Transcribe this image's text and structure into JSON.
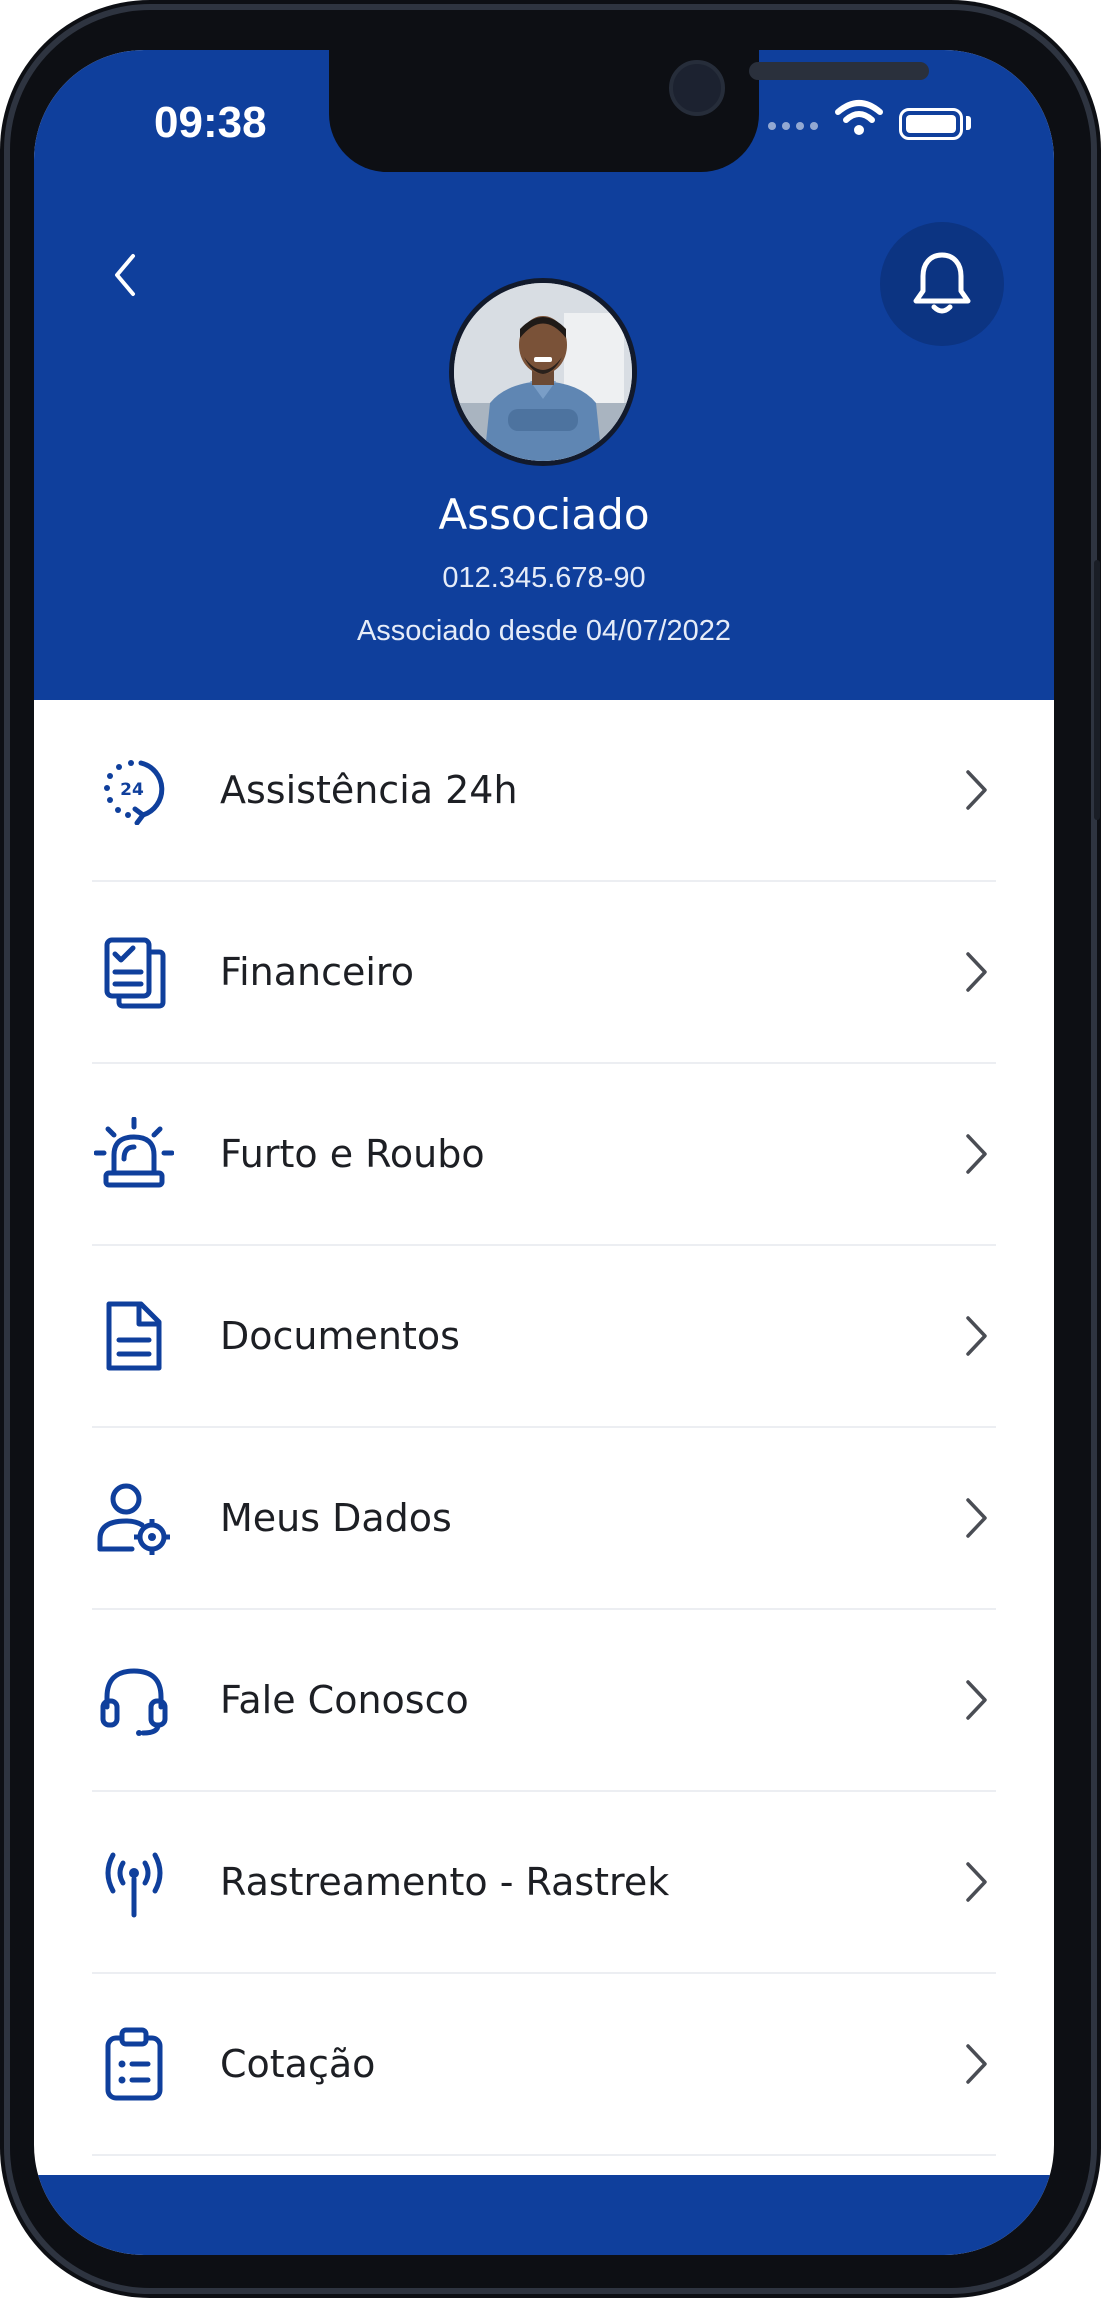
{
  "status_bar": {
    "time": "09:38"
  },
  "profile": {
    "name": "Associado",
    "document": "012.345.678-90",
    "member_since": "Associado desde 04/07/2022"
  },
  "menu": [
    {
      "label": "Assistência 24h",
      "icon": "24h-assistance-icon"
    },
    {
      "label": "Financeiro",
      "icon": "financial-document-icon"
    },
    {
      "label": "Furto e Roubo",
      "icon": "alarm-siren-icon"
    },
    {
      "label": "Documentos",
      "icon": "document-icon"
    },
    {
      "label": "Meus Dados",
      "icon": "user-settings-icon"
    },
    {
      "label": "Fale Conosco",
      "icon": "headset-icon"
    },
    {
      "label": "Rastreamento - Rastrek",
      "icon": "tracking-antenna-icon"
    },
    {
      "label": "Cotação",
      "icon": "clipboard-list-icon"
    }
  ],
  "colors": {
    "primary": "#0f3f9c",
    "icon": "#0f3f9c",
    "text": "#1d1f24"
  }
}
